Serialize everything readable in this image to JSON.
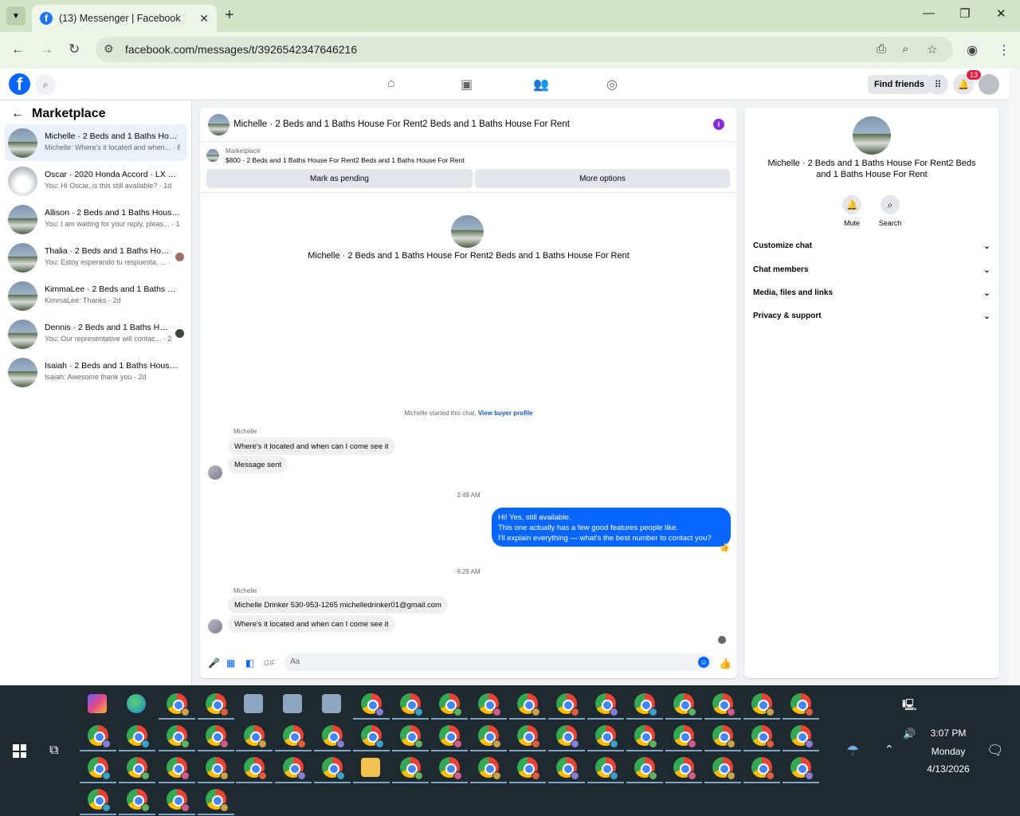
{
  "browser": {
    "tab_title": "(13) Messenger | Facebook",
    "url": "facebook.com/messages/t/3926542347646216"
  },
  "header": {
    "find_friends": "Find friends",
    "notification_count": "13"
  },
  "sidebar": {
    "title": "Marketplace",
    "conversations": [
      {
        "name": "Michelle · 2 Beds and 1 Baths House For Rent2 Beds and 1 Baths House For Rent",
        "snippet": "Michelle: Where's it located and when... · 8h",
        "active": true
      },
      {
        "name": "Oscar · 2020 Honda Accord · LX Sedan 4D",
        "snippet": "You: Hi Oscar, is this still available? · 1d"
      },
      {
        "name": "Allison · 2 Beds and 1 Baths House For Rent",
        "snippet": "You: I am waiting for your reply, pleas... · 1d"
      },
      {
        "name": "Thalia · 2 Beds and 1 Baths House For Rent",
        "snippet": "You: Estoy esperando tu respuesta, ... · 1d"
      },
      {
        "name": "KimmaLee · 2 Beds and 1 Baths House For Rent",
        "snippet": "KimmaLee: Thanks · 2d"
      },
      {
        "name": "Dennis · 2 Beds and 1 Baths House For Rent",
        "snippet": "You: Our representative will contac... · 2d"
      },
      {
        "name": "Isaiah · 2 Beds and 1 Baths House For Rent",
        "snippet": "Isaiah: Awesome thank you · 2d"
      }
    ]
  },
  "chat": {
    "title": "Michelle · 2 Beds and 1 Baths House For Rent2 Beds and 1 Baths House For Rent",
    "listing_label": "Marketplace",
    "listing_price": "$800 - 2 Beds and 1 Baths House For Rent2 Beds and 1 Baths House For Rent",
    "mark_pending": "Mark as pending",
    "more_options": "More options",
    "center_title": "Michelle · 2 Beds and 1 Baths House For Rent2 Beds and 1 Baths House For Rent",
    "started_text": "Michelle started this chat.",
    "view_buyer": "View buyer profile",
    "sender1": "Michelle",
    "msg1": "Where's it located and when can I come see it",
    "msg2": "Message sent",
    "ts1": "2:49 AM",
    "out_lines": [
      "Hi! Yes, still available.",
      "This one actually has a few good features people like.",
      "I'll explain everything — what's the best number to contact you?"
    ],
    "ts2": "6:29 AM",
    "sender2": "Michelle",
    "msg3": "Michelle Drinker 530-953-1265 michelledrinker01@gmail.com",
    "msg4": "Where's it located and when can I come see it",
    "composer_placeholder": "Aa"
  },
  "info": {
    "name": "Michelle · 2 Beds and 1 Baths House For Rent2 Beds and 1 Baths House For Rent",
    "mute": "Mute",
    "search": "Search",
    "sections": [
      "Customize chat",
      "Chat members",
      "Media, files and links",
      "Privacy & support"
    ]
  },
  "taskbar": {
    "time": "3:07 PM",
    "day": "Monday",
    "date": "4/13/2026"
  }
}
